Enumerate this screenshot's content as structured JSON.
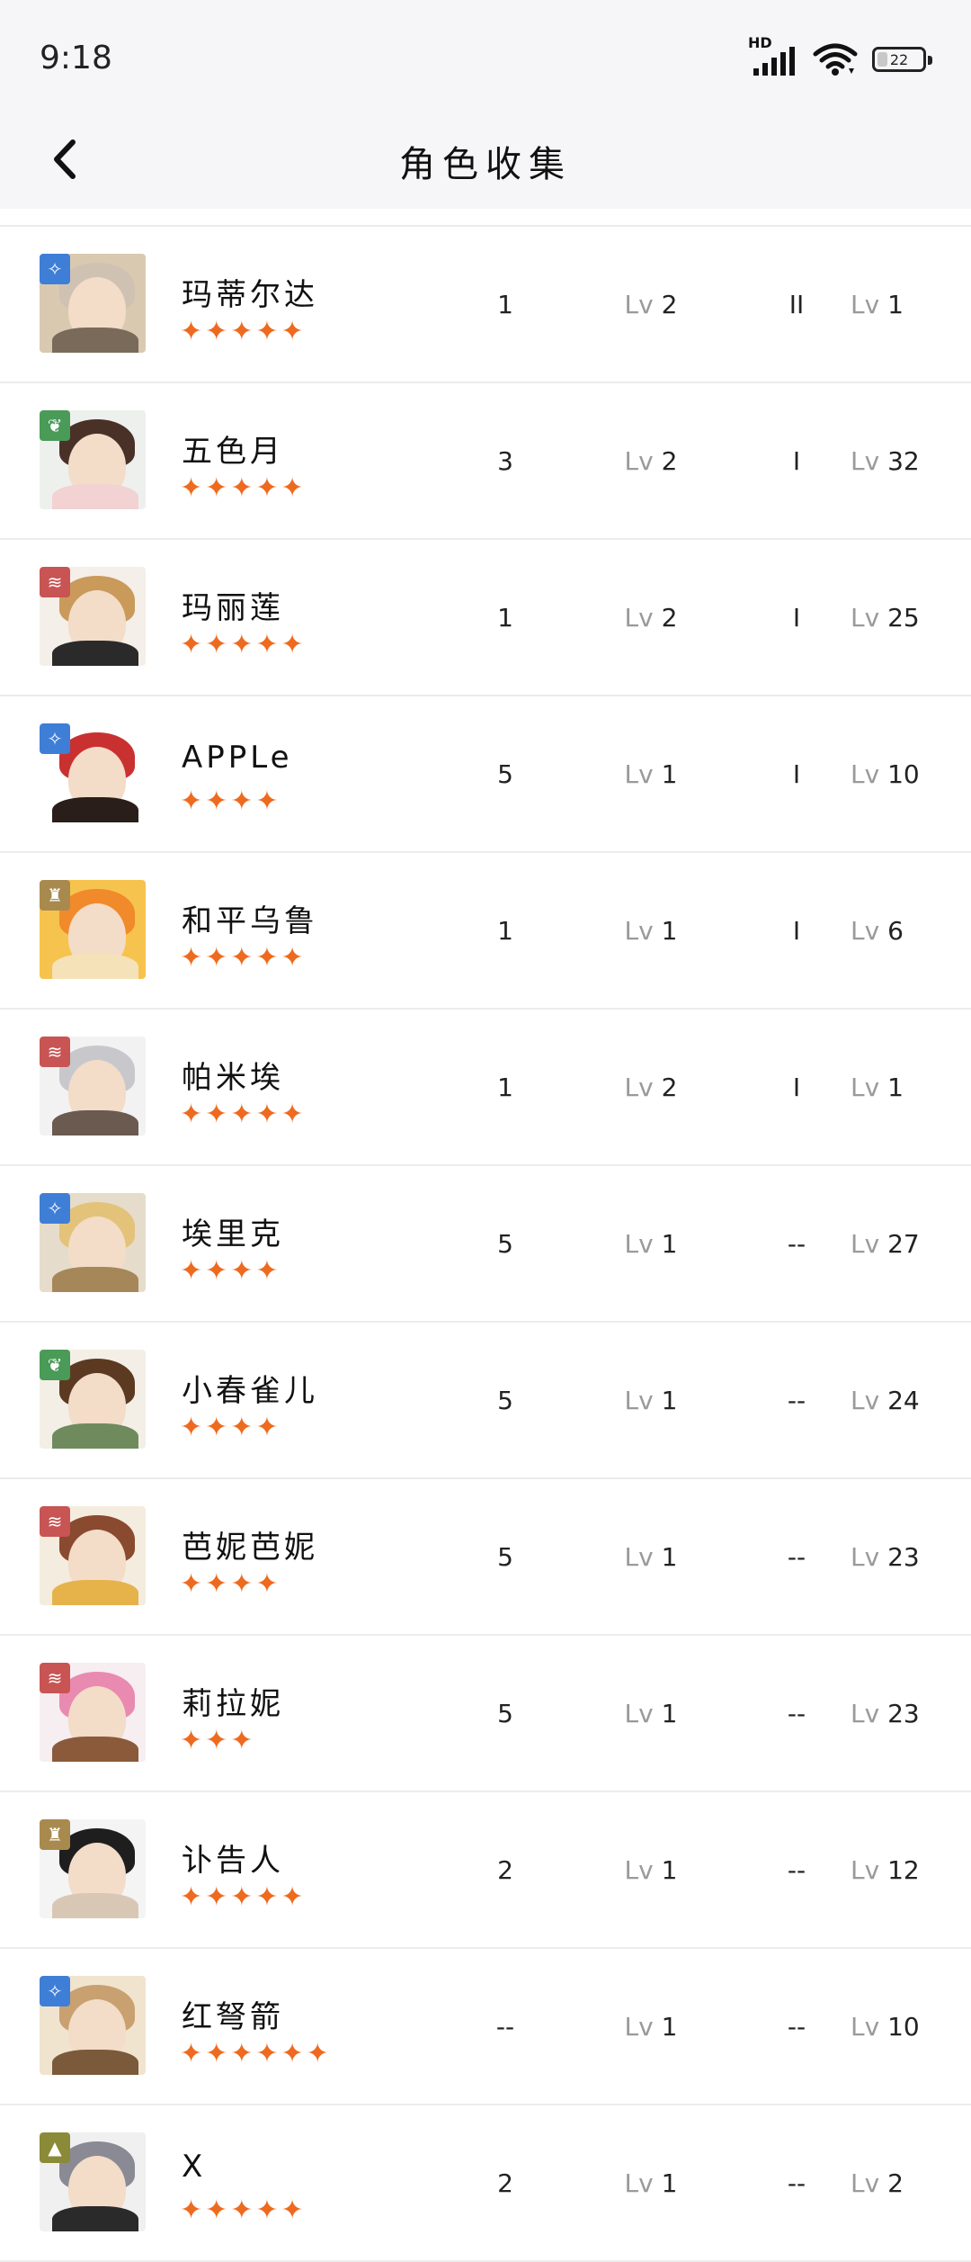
{
  "status": {
    "time": "9:18",
    "network": "HD",
    "battery": "22",
    "battery_level": 0.22
  },
  "header": {
    "title": "角色收集",
    "back_icon": "chevron-left-icon"
  },
  "colors": {
    "star": "#ee6a1f",
    "blue": "#3f7ed6",
    "green": "#4a9a58",
    "red": "#c85454",
    "gold": "#a98a4e",
    "olive": "#8a8a38"
  },
  "characters": [
    {
      "name": "玛蒂尔达",
      "stars": "✦✦✦✦✦",
      "element": "blue",
      "icon": "compass-icon",
      "c1": "1",
      "c2_label": "Lv",
      "c2": "2",
      "c3": "II",
      "c4_label": "Lv",
      "c4": "1",
      "palette": [
        "#d8c9b0",
        "#cfc2b2",
        "#7a6a5a"
      ]
    },
    {
      "name": "五色月",
      "stars": "✦✦✦✦✦",
      "element": "green",
      "icon": "leaf-icon",
      "c1": "3",
      "c2_label": "Lv",
      "c2": "2",
      "c3": "I",
      "c4_label": "Lv",
      "c4": "32",
      "palette": [
        "#eef0ee",
        "#4a3128",
        "#f2d2d2"
      ]
    },
    {
      "name": "玛丽莲",
      "stars": "✦✦✦✦✦",
      "element": "red",
      "icon": "waves-icon",
      "c1": "1",
      "c2_label": "Lv",
      "c2": "2",
      "c3": "I",
      "c4_label": "Lv",
      "c4": "25",
      "palette": [
        "#f4efe8",
        "#c99a5a",
        "#2a2a2a"
      ]
    },
    {
      "name": "APPLe",
      "stars": "✦✦✦✦",
      "element": "blue",
      "icon": "compass-icon",
      "c1": "5",
      "c2_label": "Lv",
      "c2": "1",
      "c3": "I",
      "c4_label": "Lv",
      "c4": "10",
      "palette": [
        "#ffffff",
        "#c93131",
        "#2a1e1a"
      ]
    },
    {
      "name": "和平乌鲁",
      "stars": "✦✦✦✦✦",
      "element": "gold",
      "icon": "tower-icon",
      "c1": "1",
      "c2_label": "Lv",
      "c2": "1",
      "c3": "I",
      "c4_label": "Lv",
      "c4": "6",
      "palette": [
        "#f6c34e",
        "#f08a2a",
        "#f6e2b8"
      ]
    },
    {
      "name": "帕米埃",
      "stars": "✦✦✦✦✦",
      "element": "red",
      "icon": "waves-icon",
      "c1": "1",
      "c2_label": "Lv",
      "c2": "2",
      "c3": "I",
      "c4_label": "Lv",
      "c4": "1",
      "palette": [
        "#f2f2f2",
        "#c8c8cc",
        "#6a5a50"
      ]
    },
    {
      "name": "埃里克",
      "stars": "✦✦✦✦",
      "element": "blue",
      "icon": "compass-icon",
      "c1": "5",
      "c2_label": "Lv",
      "c2": "1",
      "c3": "--",
      "c4_label": "Lv",
      "c4": "27",
      "palette": [
        "#e6dccb",
        "#e3c27a",
        "#a6875a"
      ]
    },
    {
      "name": "小春雀儿",
      "stars": "✦✦✦✦",
      "element": "green",
      "icon": "leaf-icon",
      "c1": "5",
      "c2_label": "Lv",
      "c2": "1",
      "c3": "--",
      "c4_label": "Lv",
      "c4": "24",
      "palette": [
        "#f3efe6",
        "#5c3a22",
        "#6f8b5e"
      ]
    },
    {
      "name": "芭妮芭妮",
      "stars": "✦✦✦✦",
      "element": "red",
      "icon": "waves-icon",
      "c1": "5",
      "c2_label": "Lv",
      "c2": "1",
      "c3": "--",
      "c4_label": "Lv",
      "c4": "23",
      "palette": [
        "#f4ecde",
        "#8a4a30",
        "#e6b24a"
      ]
    },
    {
      "name": "莉拉妮",
      "stars": "✦✦✦",
      "element": "red",
      "icon": "waves-icon",
      "c1": "5",
      "c2_label": "Lv",
      "c2": "1",
      "c3": "--",
      "c4_label": "Lv",
      "c4": "23",
      "palette": [
        "#f6eef0",
        "#e98ab0",
        "#8a5a3a"
      ]
    },
    {
      "name": "讣告人",
      "stars": "✦✦✦✦✦",
      "element": "gold",
      "icon": "tower-icon",
      "c1": "2",
      "c2_label": "Lv",
      "c2": "1",
      "c3": "--",
      "c4_label": "Lv",
      "c4": "12",
      "palette": [
        "#f4f4f4",
        "#1e1e1e",
        "#d9c7b6"
      ]
    },
    {
      "name": "红弩箭",
      "stars": "✦✦✦✦✦✦",
      "element": "blue",
      "icon": "compass-icon",
      "c1": "--",
      "c2_label": "Lv",
      "c2": "1",
      "c3": "--",
      "c4_label": "Lv",
      "c4": "10",
      "palette": [
        "#f0e4cf",
        "#c9a070",
        "#7a5a3a"
      ]
    },
    {
      "name": "X",
      "stars": "✦✦✦✦✦",
      "element": "olive",
      "icon": "triangle-icon",
      "c1": "2",
      "c2_label": "Lv",
      "c2": "1",
      "c3": "--",
      "c4_label": "Lv",
      "c4": "2",
      "palette": [
        "#f0f0f0",
        "#8a8a94",
        "#2a2a2a"
      ]
    }
  ]
}
